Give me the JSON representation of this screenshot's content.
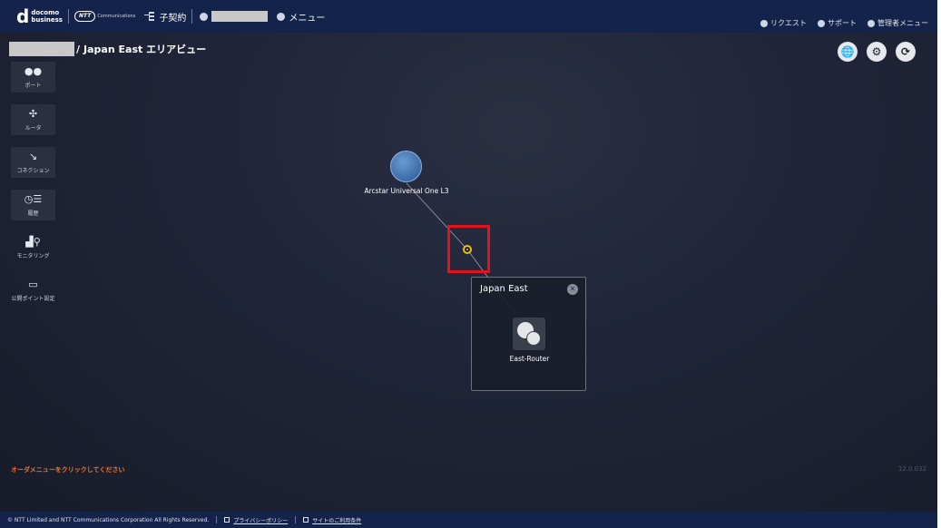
{
  "header": {
    "brand_d": "d",
    "brand_line1": "docomo",
    "brand_line2": "business",
    "ntt_logo": "NTT",
    "ntt_sub": "Communications",
    "subcontract_label": "子契約",
    "menu_label": "メニュー",
    "right": {
      "request": "リクエスト",
      "support": "サポート",
      "admin_menu": "管理者メニュー"
    }
  },
  "breadcrumb": {
    "separator": "/",
    "current": "Japan East エリアビュー"
  },
  "view_tools": {
    "globe_icon": "🌐",
    "settings_icon": "⚙",
    "refresh_icon": "⟳"
  },
  "sidebar": {
    "items": [
      {
        "label": "ポート",
        "icon": "●●"
      },
      {
        "label": "ルータ",
        "icon": "✣"
      },
      {
        "label": "コネクション",
        "icon": "↘"
      },
      {
        "label": "履歴",
        "icon": "◷☰"
      },
      {
        "label": "モニタリング",
        "icon": "▟⚲"
      },
      {
        "label": "公開ポイント設定",
        "icon": "▭"
      }
    ]
  },
  "topology": {
    "cloud_node_label": "Arcstar Universal One L3",
    "area_title": "Japan East",
    "area_close": "✕",
    "router_label": "East-Router"
  },
  "status": {
    "order_hint": "オーダメニューをクリックしてください",
    "version": "12.0.032"
  },
  "footer": {
    "copyright": "© NTT Limited and NTT Communications Corporation All Rights Reserved.",
    "privacy": "プライバシーポリシー",
    "terms": "サイトのご利用条件"
  },
  "colors": {
    "header_bg": "#13234a",
    "canvas_bg": "#1c2030",
    "highlight": "#e0141c",
    "connection_marker": "#e8c218",
    "hint_text": "#f0722a"
  }
}
